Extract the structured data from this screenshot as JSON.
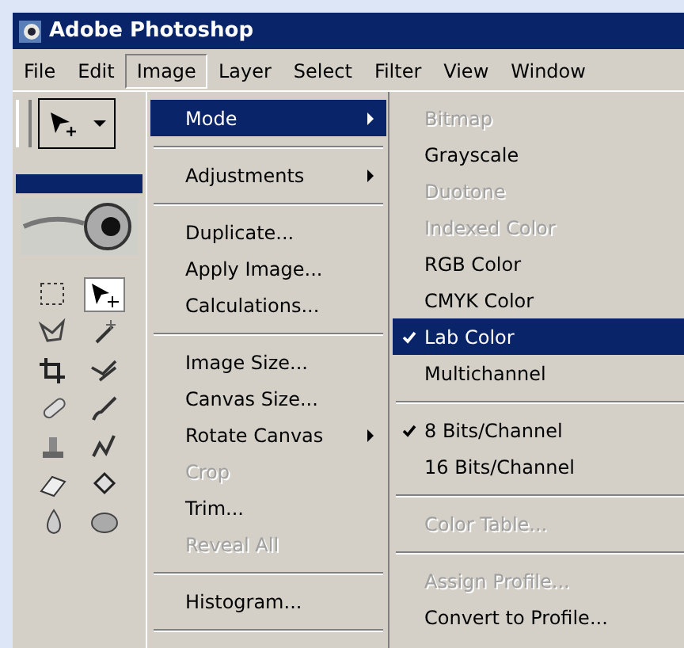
{
  "window": {
    "title": "Adobe Photoshop"
  },
  "menubar": [
    {
      "label": "File",
      "selected": false
    },
    {
      "label": "Edit",
      "selected": false
    },
    {
      "label": "Image",
      "selected": true
    },
    {
      "label": "Layer",
      "selected": false
    },
    {
      "label": "Select",
      "selected": false
    },
    {
      "label": "Filter",
      "selected": false
    },
    {
      "label": "View",
      "selected": false
    },
    {
      "label": "Window",
      "selected": false
    }
  ],
  "toolbox": {
    "tools": [
      {
        "selected": false
      },
      {
        "selected": true
      },
      {
        "selected": false
      },
      {
        "selected": false
      },
      {
        "selected": false
      },
      {
        "selected": false
      },
      {
        "selected": false
      },
      {
        "selected": false
      },
      {
        "selected": false
      },
      {
        "selected": false
      },
      {
        "selected": false
      },
      {
        "selected": false
      },
      {
        "selected": false
      },
      {
        "selected": false
      }
    ]
  },
  "image_menu": [
    {
      "kind": "item",
      "label": "Mode",
      "selected": true,
      "disabled": false,
      "submenu": true
    },
    {
      "kind": "separator"
    },
    {
      "kind": "item",
      "label": "Adjustments",
      "selected": false,
      "disabled": false,
      "submenu": true
    },
    {
      "kind": "separator"
    },
    {
      "kind": "item",
      "label": "Duplicate...",
      "selected": false,
      "disabled": false,
      "submenu": false
    },
    {
      "kind": "item",
      "label": "Apply Image...",
      "selected": false,
      "disabled": false,
      "submenu": false
    },
    {
      "kind": "item",
      "label": "Calculations...",
      "selected": false,
      "disabled": false,
      "submenu": false
    },
    {
      "kind": "separator"
    },
    {
      "kind": "item",
      "label": "Image Size...",
      "selected": false,
      "disabled": false,
      "submenu": false
    },
    {
      "kind": "item",
      "label": "Canvas Size...",
      "selected": false,
      "disabled": false,
      "submenu": false
    },
    {
      "kind": "item",
      "label": "Rotate Canvas",
      "selected": false,
      "disabled": false,
      "submenu": true
    },
    {
      "kind": "item",
      "label": "Crop",
      "selected": false,
      "disabled": true,
      "submenu": false
    },
    {
      "kind": "item",
      "label": "Trim...",
      "selected": false,
      "disabled": false,
      "submenu": false
    },
    {
      "kind": "item",
      "label": "Reveal All",
      "selected": false,
      "disabled": true,
      "submenu": false
    },
    {
      "kind": "separator"
    },
    {
      "kind": "item",
      "label": "Histogram...",
      "selected": false,
      "disabled": false,
      "submenu": false
    },
    {
      "kind": "separator"
    }
  ],
  "mode_submenu": [
    {
      "kind": "item",
      "label": "Bitmap",
      "selected": false,
      "disabled": true,
      "checked": false
    },
    {
      "kind": "item",
      "label": "Grayscale",
      "selected": false,
      "disabled": false,
      "checked": false
    },
    {
      "kind": "item",
      "label": "Duotone",
      "selected": false,
      "disabled": true,
      "checked": false
    },
    {
      "kind": "item",
      "label": "Indexed Color",
      "selected": false,
      "disabled": true,
      "checked": false
    },
    {
      "kind": "item",
      "label": "RGB Color",
      "selected": false,
      "disabled": false,
      "checked": false
    },
    {
      "kind": "item",
      "label": "CMYK Color",
      "selected": false,
      "disabled": false,
      "checked": false
    },
    {
      "kind": "item",
      "label": "Lab Color",
      "selected": true,
      "disabled": false,
      "checked": true
    },
    {
      "kind": "item",
      "label": "Multichannel",
      "selected": false,
      "disabled": false,
      "checked": false
    },
    {
      "kind": "separator"
    },
    {
      "kind": "item",
      "label": "8 Bits/Channel",
      "selected": false,
      "disabled": false,
      "checked": true
    },
    {
      "kind": "item",
      "label": "16 Bits/Channel",
      "selected": false,
      "disabled": false,
      "checked": false
    },
    {
      "kind": "separator"
    },
    {
      "kind": "item",
      "label": "Color Table...",
      "selected": false,
      "disabled": true,
      "checked": false
    },
    {
      "kind": "separator"
    },
    {
      "kind": "item",
      "label": "Assign Profile...",
      "selected": false,
      "disabled": true,
      "checked": false
    },
    {
      "kind": "item",
      "label": "Convert to Profile...",
      "selected": false,
      "disabled": false,
      "checked": false
    }
  ]
}
